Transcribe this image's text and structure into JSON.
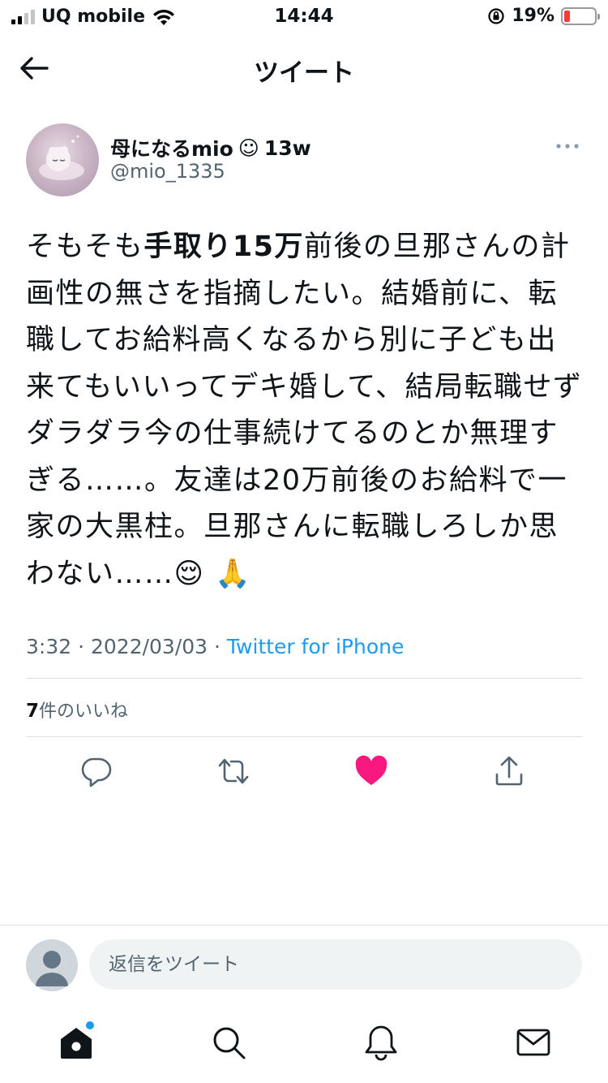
{
  "status_bar": {
    "carrier": "UQ mobile",
    "time": "14:44",
    "battery_percent": "19%",
    "battery_level": 0.19,
    "battery_color": "#f23b3b"
  },
  "header": {
    "title": "ツイート"
  },
  "tweet": {
    "author": {
      "display_name": "母になるmio",
      "emoji": "☺",
      "suffix": "13w",
      "handle": "@mio_1335"
    },
    "text_parts": {
      "t1": "そもそも",
      "t2": "手取り15万",
      "t3": "前後の旦那さんの計画性の無さを指摘したい。結婚前に、転職してお給料高くなるから別に子ども出来てもいいってデキ婚して、結局転職せずダラダラ今の仕事続けてるのとか無理すぎる……。友達は20万前後のお給料で一家の大黒柱。旦那さんに転職しろしか思わない……",
      "t4": "😌 🙏"
    },
    "time": "3:32",
    "date": "2022/03/03",
    "separator": " · ",
    "source": "Twitter for iPhone",
    "likes_count": "7",
    "likes_label": "件のいいね",
    "liked": true
  },
  "colors": {
    "accent": "#1d9bf0",
    "like": "#f91880",
    "secondary_text": "#536471"
  },
  "icons": {
    "reply": "reply-icon",
    "retweet": "retweet-icon",
    "like": "heart-icon",
    "share": "share-icon",
    "home": "home-icon",
    "search": "search-icon",
    "notifications": "bell-icon",
    "messages": "mail-icon"
  },
  "composer": {
    "placeholder": "返信をツイート"
  }
}
